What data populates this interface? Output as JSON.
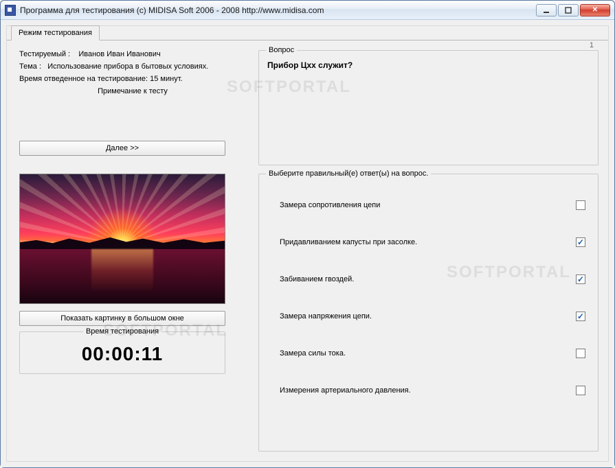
{
  "window": {
    "title": "Программа для тестирования (c) MIDISA Soft 2006 - 2008 http://www.midisa.com"
  },
  "tab": {
    "label": "Режим тестирования"
  },
  "info": {
    "testee_label": "Тестируемый :",
    "testee_name": "Иванов Иван Иванович",
    "topic_label": "Тема :",
    "topic_value": "Использование прибора в бытовых условиях.",
    "time_limit": "Время отведенное на тестирование: 15 минут.",
    "note_link": "Примечание к тесту"
  },
  "buttons": {
    "next": "Далее >>",
    "show_image": "Показать картинку в большом окне"
  },
  "question": {
    "group_label": "Вопрос",
    "number": "1",
    "text": "Прибор Цхх служит?"
  },
  "answers": {
    "group_label": "Выберите правильный(е) ответ(ы) на вопрос.",
    "items": [
      {
        "label": "Замера сопротивления цепи",
        "checked": false
      },
      {
        "label": "Придавливанием капусты при засолке.",
        "checked": true
      },
      {
        "label": "Забиванием гвоздей.",
        "checked": true
      },
      {
        "label": "Замера напряжения цепи.",
        "checked": true
      },
      {
        "label": "Замера силы тока.",
        "checked": false
      },
      {
        "label": "Измерения артериального давления.",
        "checked": false
      }
    ]
  },
  "timer": {
    "group_label": "Время тестирования",
    "value": "00:00:11"
  },
  "watermark": "SOFTPORTAL"
}
